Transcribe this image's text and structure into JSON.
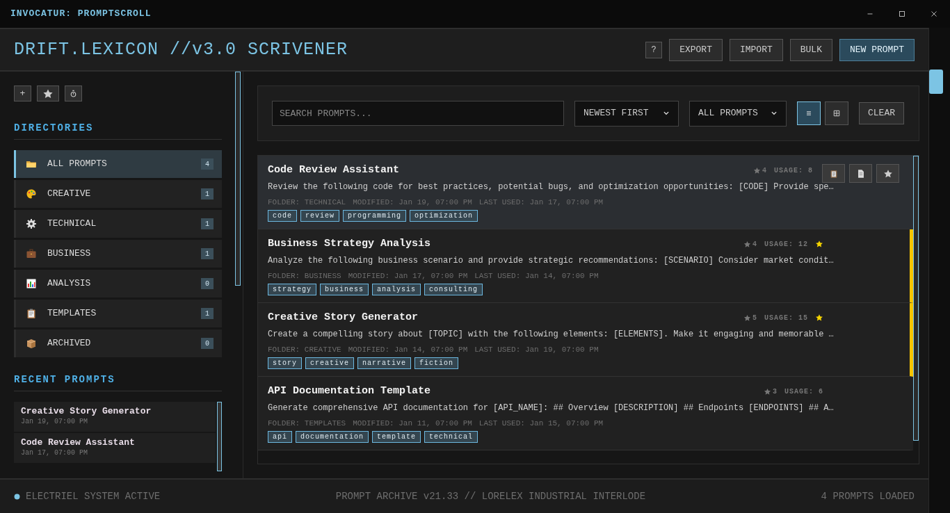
{
  "window": {
    "title": "INVOCATUR: PROMPTSCROLL"
  },
  "header": {
    "title": "DRIFT.LEXICON //v3.0 SCRIVENER",
    "help": "?",
    "buttons": [
      {
        "label": "EXPORT",
        "primary": false
      },
      {
        "label": "IMPORT",
        "primary": false
      },
      {
        "label": "BULK",
        "primary": false
      },
      {
        "label": "NEW PROMPT",
        "primary": true
      }
    ]
  },
  "sidebar": {
    "quick_buttons": [
      "+"
    ],
    "directories_heading": "DIRECTORIES",
    "directories": [
      {
        "label": "ALL PROMPTS",
        "count": "4",
        "selected": true
      },
      {
        "label": "CREATIVE",
        "count": "1",
        "selected": false
      },
      {
        "label": "TECHNICAL",
        "count": "1",
        "selected": false
      },
      {
        "label": "BUSINESS",
        "count": "1",
        "selected": false
      },
      {
        "label": "ANALYSIS",
        "count": "0",
        "selected": false
      },
      {
        "label": "TEMPLATES",
        "count": "1",
        "selected": false
      },
      {
        "label": "ARCHIVED",
        "count": "0",
        "selected": false
      }
    ],
    "recent_heading": "RECENT PROMPTS",
    "recent": [
      {
        "title": "Creative Story Generator",
        "date": "Jan 19, 07:00 PM"
      },
      {
        "title": "Code Review Assistant",
        "date": "Jan 17, 07:00 PM"
      }
    ]
  },
  "toolbar": {
    "search": {
      "placeholder": "SEARCH PROMPTS..."
    },
    "sort": "NEWEST FIRST",
    "filter": "ALL PROMPTS",
    "views": [
      {
        "kind": "list",
        "selected": true
      },
      {
        "kind": "grid",
        "selected": false
      }
    ],
    "clear": "CLEAR"
  },
  "prompts": [
    {
      "title": "Code Review Assistant",
      "rating": "4",
      "usage": "USAGE: 8",
      "favorite": false,
      "selected": true,
      "description": "Review the following code for best practices, potential bugs, and optimization opportunities: [CODE] Provide spe…",
      "folder": "FOLDER: TECHNICAL",
      "modified": "MODIFIED: Jan 19, 07:00 PM",
      "last_used": "LAST USED: Jan 17, 07:00 PM",
      "tags": [
        "code",
        "review",
        "programming",
        "optimization"
      ]
    },
    {
      "title": "Business Strategy Analysis",
      "rating": "4",
      "usage": "USAGE: 12",
      "favorite": true,
      "selected": false,
      "description": "Analyze the following business scenario and provide strategic recommendations: [SCENARIO] Consider market condit…",
      "folder": "FOLDER: BUSINESS",
      "modified": "MODIFIED: Jan 17, 07:00 PM",
      "last_used": "LAST USED: Jan 14, 07:00 PM",
      "tags": [
        "strategy",
        "business",
        "analysis",
        "consulting"
      ]
    },
    {
      "title": "Creative Story Generator",
      "rating": "5",
      "usage": "USAGE: 15",
      "favorite": true,
      "selected": false,
      "description": "Create a compelling story about [TOPIC] with the following elements: [ELEMENTS]. Make it engaging and memorable …",
      "folder": "FOLDER: CREATIVE",
      "modified": "MODIFIED: Jan 14, 07:00 PM",
      "last_used": "LAST USED: Jan 19, 07:00 PM",
      "tags": [
        "story",
        "creative",
        "narrative",
        "fiction"
      ]
    },
    {
      "title": "API Documentation Template",
      "rating": "3",
      "usage": "USAGE: 6",
      "favorite": false,
      "selected": false,
      "description": "Generate comprehensive API documentation for [API_NAME]: ## Overview [DESCRIPTION] ## Endpoints [ENDPOINTS] ## A…",
      "folder": "FOLDER: TEMPLATES",
      "modified": "MODIFIED: Jan 11, 07:00 PM",
      "last_used": "LAST USED: Jan 15, 07:00 PM",
      "tags": [
        "api",
        "documentation",
        "template",
        "technical"
      ]
    }
  ],
  "status_bar": {
    "left": "ELECTRIEL SYSTEM ACTIVE",
    "center": "PROMPT ARCHIVE v21.33 // LORELEX INDUSTRIAL INTERLODE",
    "right": "4 PROMPTS LOADED"
  }
}
